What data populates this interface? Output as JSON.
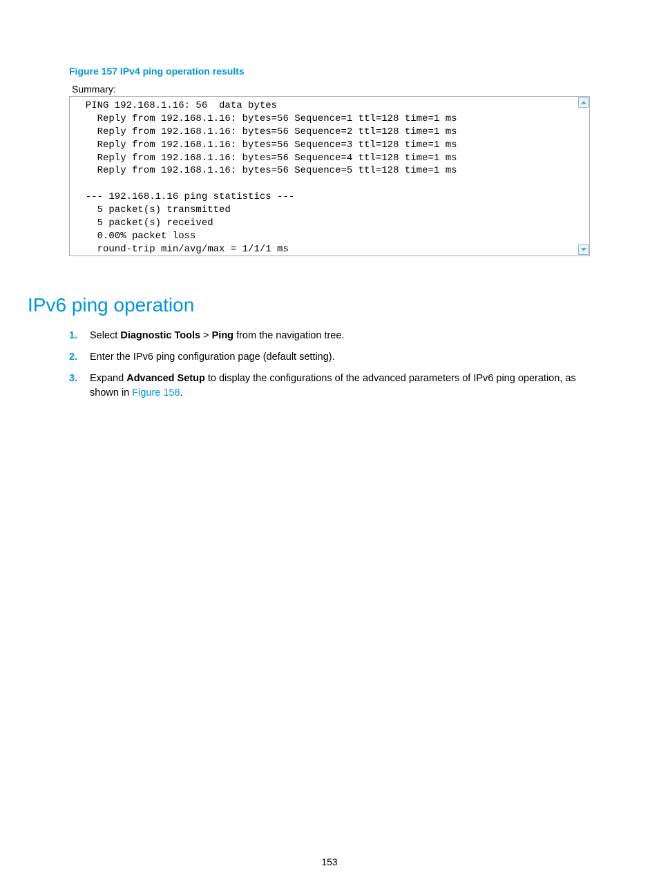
{
  "figure": {
    "caption": "Figure 157 IPv4 ping operation results",
    "summary_label": "Summary:",
    "content": "  PING 192.168.1.16: 56  data bytes\n    Reply from 192.168.1.16: bytes=56 Sequence=1 ttl=128 time=1 ms\n    Reply from 192.168.1.16: bytes=56 Sequence=2 ttl=128 time=1 ms\n    Reply from 192.168.1.16: bytes=56 Sequence=3 ttl=128 time=1 ms\n    Reply from 192.168.1.16: bytes=56 Sequence=4 ttl=128 time=1 ms\n    Reply from 192.168.1.16: bytes=56 Sequence=5 ttl=128 time=1 ms\n\n  --- 192.168.1.16 ping statistics ---\n    5 packet(s) transmitted\n    5 packet(s) received\n    0.00% packet loss\n    round-trip min/avg/max = 1/1/1 ms"
  },
  "section": {
    "title": "IPv6 ping operation"
  },
  "steps": {
    "s1_a": "Select ",
    "s1_b": "Diagnostic Tools",
    "s1_c": " > ",
    "s1_d": "Ping",
    "s1_e": " from the navigation tree.",
    "s2": "Enter the IPv6 ping configuration page (default setting).",
    "s3_a": "Expand ",
    "s3_b": "Advanced Setup",
    "s3_c": " to display the configurations of the advanced parameters of IPv6 ping operation, as shown in ",
    "s3_d": "Figure 158",
    "s3_e": "."
  },
  "page_number": "153"
}
